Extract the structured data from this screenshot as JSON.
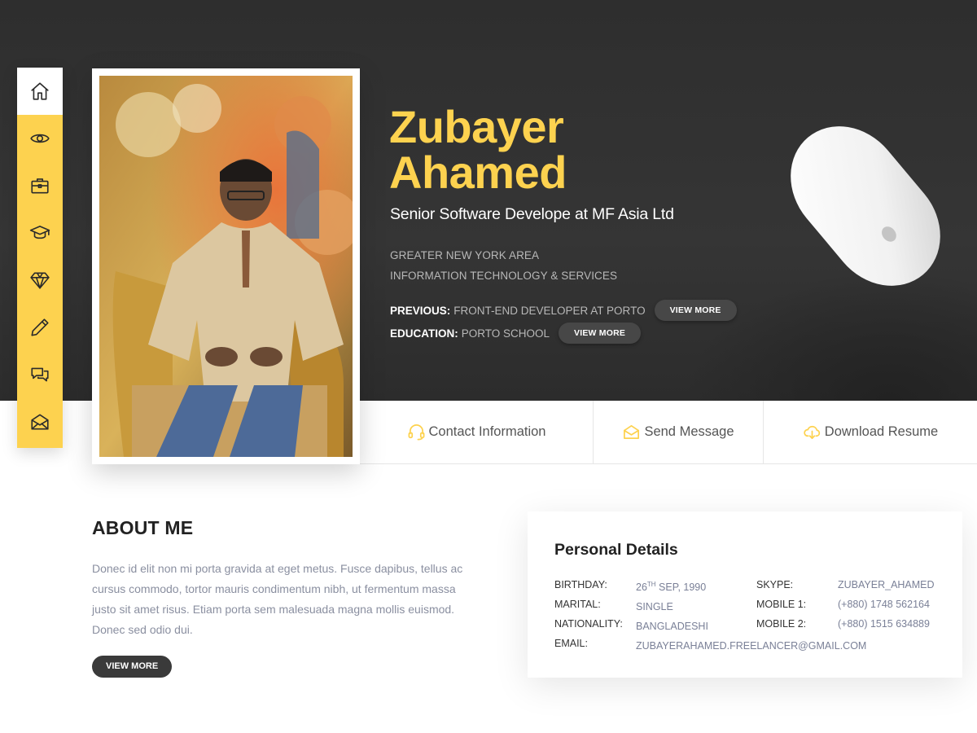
{
  "nav": {
    "items": [
      {
        "icon": "home-icon",
        "active": true
      },
      {
        "icon": "eye-icon"
      },
      {
        "icon": "briefcase-icon"
      },
      {
        "icon": "graduation-cap-icon"
      },
      {
        "icon": "diamond-icon"
      },
      {
        "icon": "pencil-icon"
      },
      {
        "icon": "chat-bubbles-icon"
      },
      {
        "icon": "envelope-icon"
      }
    ],
    "accent_color": "#fdd24f"
  },
  "profile": {
    "first_name": "Zubayer",
    "last_name": "Ahamed",
    "role": "Senior Software Develope at MF Asia Ltd",
    "location": "GREATER NEW YORK AREA",
    "industry": "INFORMATION TECHNOLOGY & SERVICES",
    "previous_label": "PREVIOUS:",
    "previous_value": "FRONT-END DEVELOPER AT PORTO",
    "education_label": "EDUCATION:",
    "education_value": "PORTO SCHOOL",
    "view_more_label": "VIEW MORE"
  },
  "actions": {
    "contact": "Contact Information",
    "message": "Send Message",
    "resume": "Download Resume"
  },
  "about": {
    "title": "ABOUT ME",
    "text": "Donec id elit non mi porta gravida at eget metus. Fusce dapibus, tellus ac cursus commodo, tortor mauris condimentum nibh, ut fermentum massa justo sit amet risus. Etiam porta sem malesuada magna mollis euismod. Donec sed odio dui.",
    "button": "VIEW MORE"
  },
  "details": {
    "title": "Personal Details",
    "birthday_label": "BIRTHDAY:",
    "birthday_day": "26",
    "birthday_suffix": "TH",
    "birthday_rest": " SEP, 1990",
    "marital_label": "MARITAL:",
    "marital_value": "SINGLE",
    "nationality_label": "NATIONALITY:",
    "nationality_value": "BANGLADESHI",
    "email_label": "EMAIL:",
    "email_value": "ZUBAYERAHAMED.FREELANCER@GMAIL.COM",
    "skype_label": "SKYPE:",
    "skype_value": "ZUBAYER_AHAMED",
    "mobile1_label": "MOBILE 1:",
    "mobile1_value": "(+880) 1748 562164",
    "mobile2_label": "MOBILE 2:",
    "mobile2_value": "(+880) 1515 634889"
  }
}
